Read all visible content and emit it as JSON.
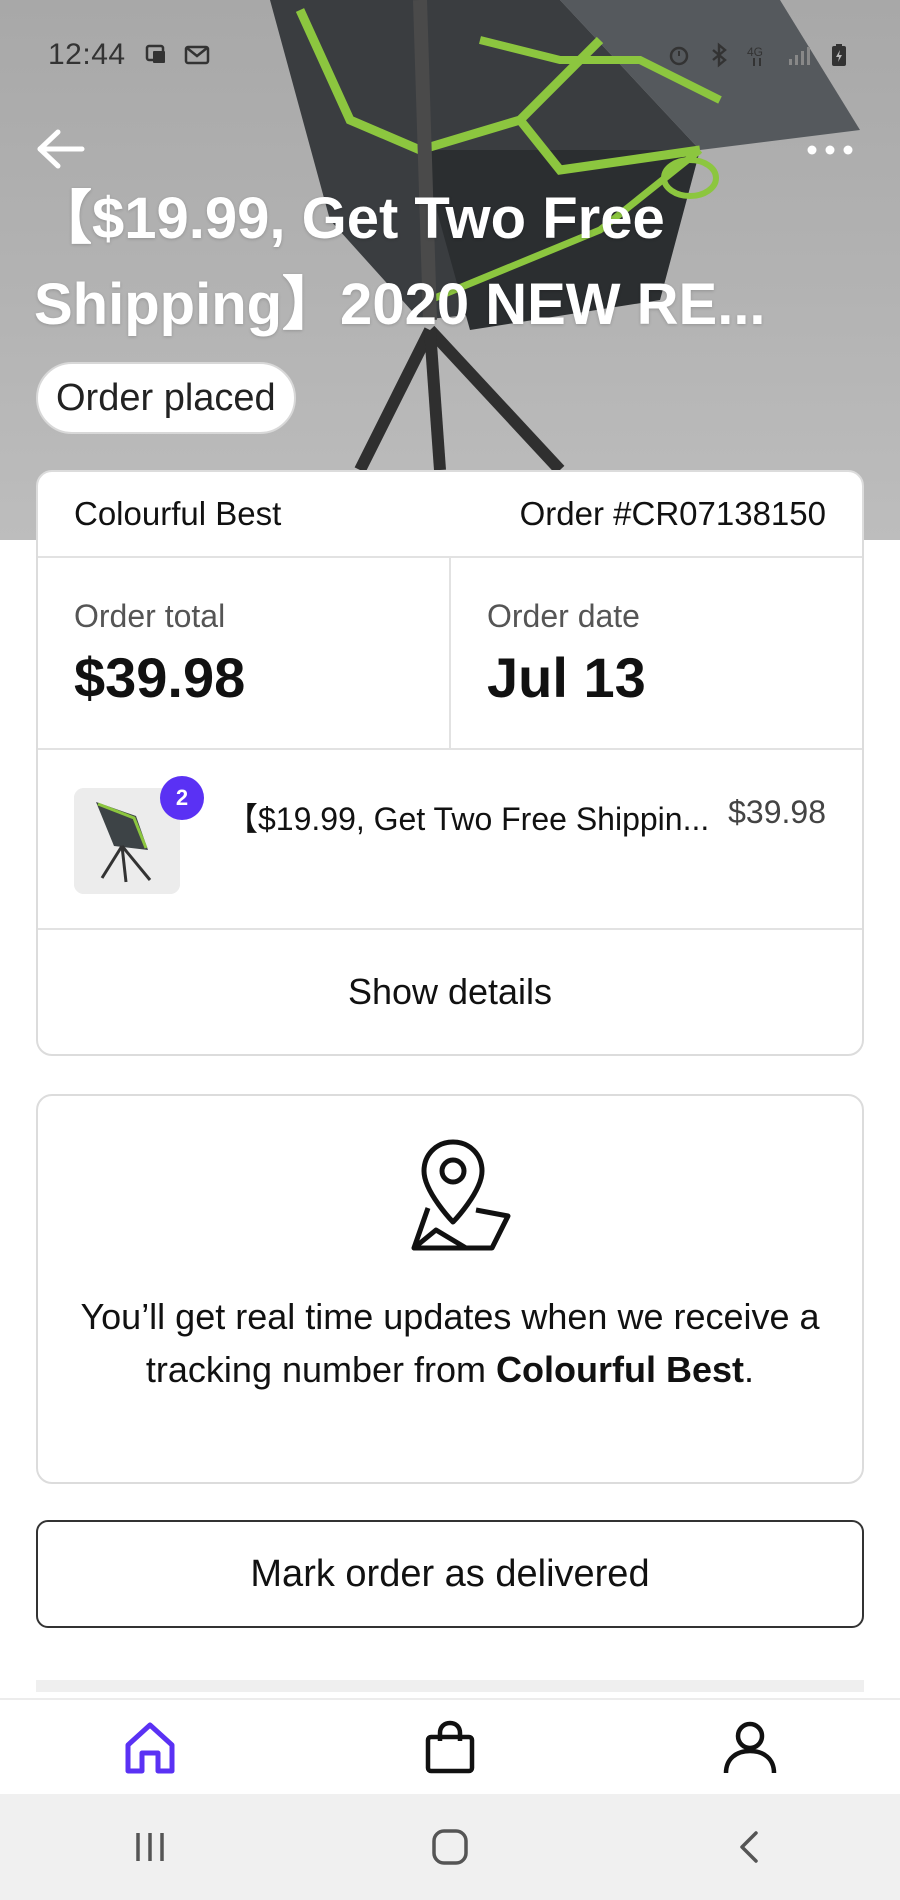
{
  "status_bar": {
    "time": "12:44",
    "left_icons": [
      "screen-cast-icon",
      "gmail-icon"
    ],
    "right_icons": [
      "alarm-icon",
      "bluetooth-icon",
      "lte-4g-icon",
      "signal-icon",
      "battery-charging-icon"
    ]
  },
  "header": {
    "back_icon": "arrow-left-icon",
    "more_icon": "more-dots-icon",
    "title": "【$19.99, Get Two Free Shipping】2020 NEW RE...",
    "status": "Order placed"
  },
  "order": {
    "store_name": "Colourful Best",
    "order_number": "Order #CR07138150",
    "total_label": "Order total",
    "total_value": "$39.98",
    "date_label": "Order date",
    "date_value": "Jul 13",
    "item": {
      "quantity": "2",
      "title": "【$19.99, Get Two Free Shippin...",
      "price": "$39.98"
    },
    "show_details": "Show details"
  },
  "tracking": {
    "icon": "map-pin-icon",
    "text_before": "You’ll get real time updates when we receive a tracking number from ",
    "store": "Colourful Best",
    "text_after": "."
  },
  "actions": {
    "mark_delivered": "Mark order as delivered"
  },
  "bottom_nav": {
    "items": [
      {
        "icon": "home-icon",
        "active": true
      },
      {
        "icon": "shopping-bag-icon",
        "active": false
      },
      {
        "icon": "account-icon",
        "active": false
      }
    ],
    "active_color": "#5a31f4"
  },
  "system_nav": [
    "recent-apps-icon",
    "home-circle-icon",
    "back-chevron-icon"
  ]
}
